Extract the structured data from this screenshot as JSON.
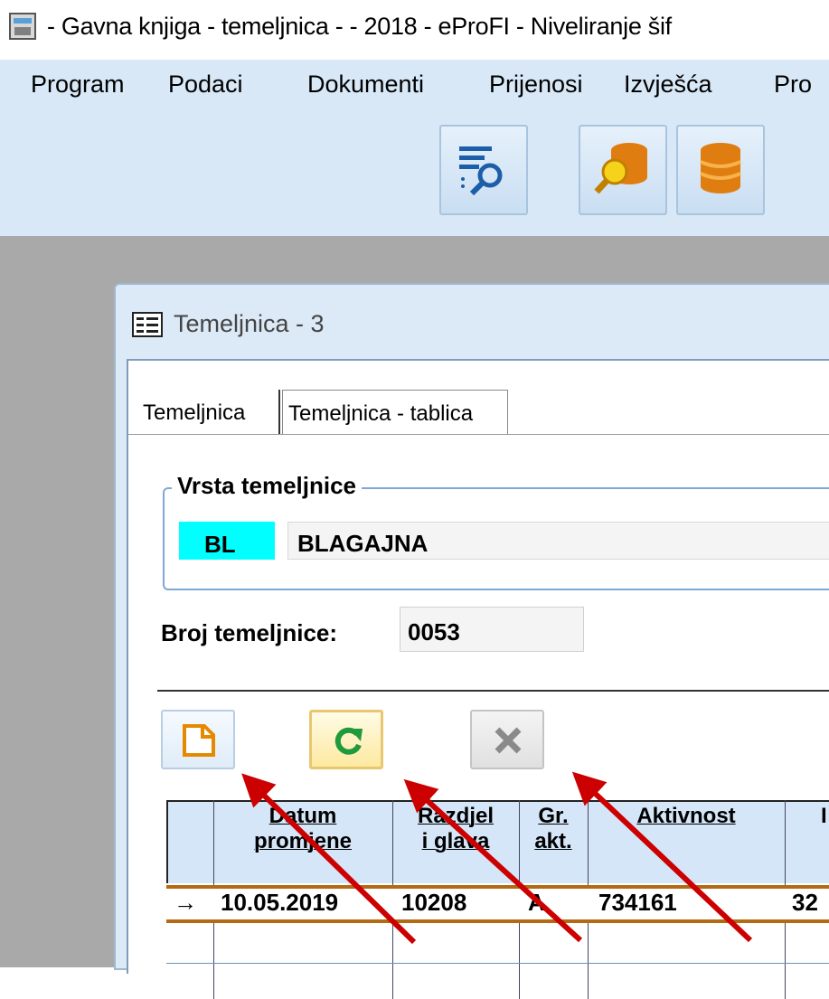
{
  "window": {
    "title": "- Gavna knjiga - temeljnica - - 2018 - eProFI - Niveliranje šif"
  },
  "menu": {
    "items": [
      {
        "label": "Program"
      },
      {
        "label": "Podaci"
      },
      {
        "label": "Dokumenti"
      },
      {
        "label": "Prijenosi"
      },
      {
        "label": "Izvješća"
      },
      {
        "label": "Pro"
      }
    ]
  },
  "toolbar": {
    "buttons": [
      {
        "icon": "filter-search-icon"
      },
      {
        "icon": "database-search-icon"
      },
      {
        "icon": "database-icon"
      }
    ]
  },
  "child": {
    "title": "Temeljnica - 3",
    "tabs": [
      {
        "label": "Temeljnica"
      },
      {
        "label": "Temeljnica - tablica"
      }
    ],
    "group_label": "Vrsta temeljnice",
    "vrsta_code": "BL",
    "vrsta_name": "BLAGAJNA",
    "broj_label": "Broj temeljnice:",
    "broj_value": "0053"
  },
  "actions": {
    "new_icon": "new-document-icon",
    "refresh_icon": "refresh-icon",
    "delete_icon": "delete-icon"
  },
  "grid": {
    "headers": [
      {
        "line1": "Datum",
        "line2": "promjene"
      },
      {
        "line1": "Razdjel",
        "line2": "i glava"
      },
      {
        "line1": "Gr.",
        "line2": "akt."
      },
      {
        "line1": "Aktivnost",
        "line2": ""
      },
      {
        "line1": "",
        "line2": "I"
      }
    ],
    "rows": [
      {
        "marker": "→",
        "datum": "10.05.2019",
        "razdjel": "10208",
        "gr": "A",
        "aktivnost": "734161",
        "next": "32"
      }
    ]
  },
  "colors": {
    "menubar": "#d8e8f7",
    "mdi_bg": "#a9a9a9",
    "code_bg": "#00ffff",
    "arrow": "#cc0000",
    "selected_row_border": "#b36a12"
  }
}
